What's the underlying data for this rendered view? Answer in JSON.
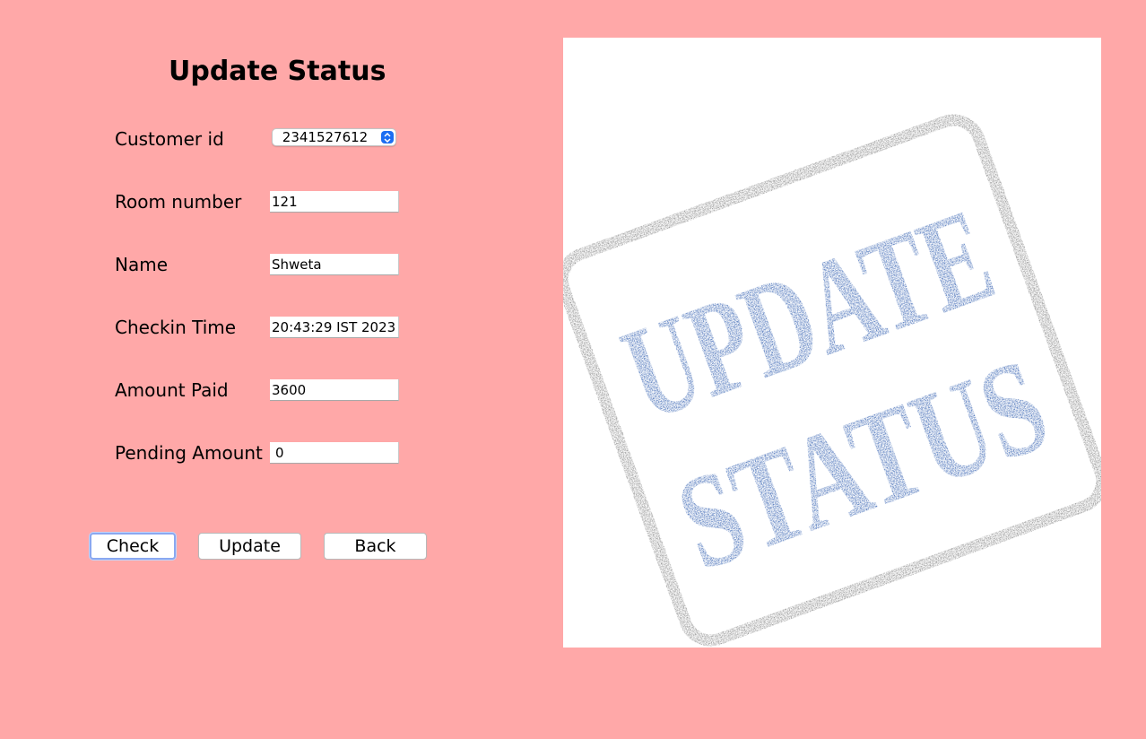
{
  "form": {
    "title": "Update Status",
    "customer_id_label": "Customer id",
    "customer_id_selected": "2341527612",
    "room_number_label": "Room number",
    "room_number_value": "121",
    "name_label": "Name",
    "name_value": "Shweta",
    "checkin_time_label": "Checkin Time",
    "checkin_time_value": "20:43:29 IST 2023",
    "amount_paid_label": "Amount Paid",
    "amount_paid_value": "3600",
    "pending_amount_label": "Pending Amount",
    "pending_amount_value": "0"
  },
  "buttons": {
    "check": "Check",
    "update": "Update",
    "back": "Back"
  },
  "stamp": {
    "line1": "UPDATE",
    "line2": "STATUS"
  },
  "colors": {
    "background": "#FFA8A8",
    "stamp_blue": "#1E4FA8",
    "stamp_border": "#7A7A7A",
    "focus_ring": "#8AA8F0"
  }
}
